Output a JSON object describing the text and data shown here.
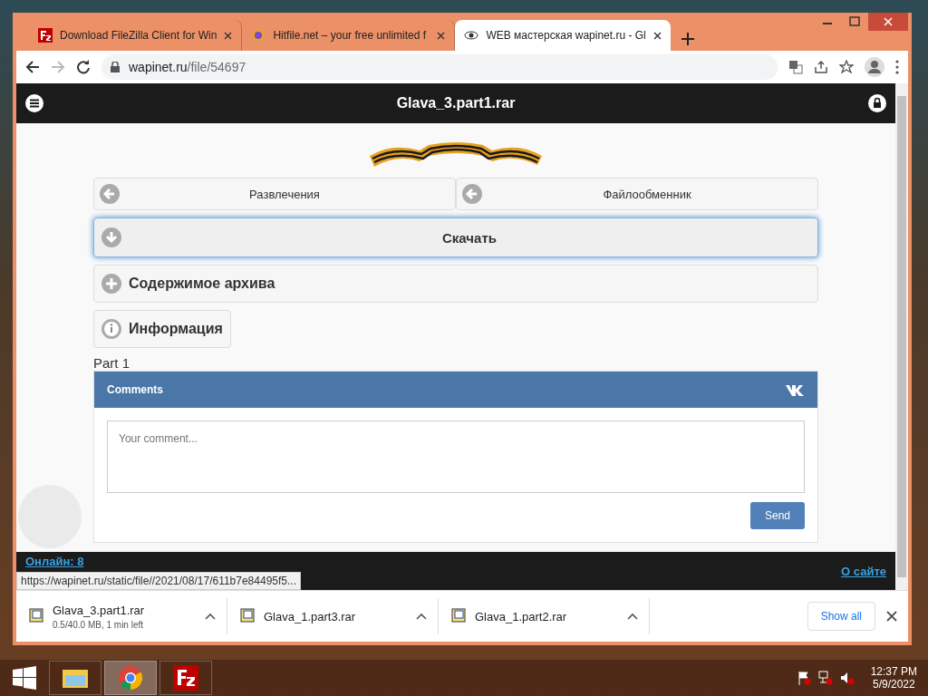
{
  "browser": {
    "tabs": [
      {
        "title": "Download FileZilla Client for Win",
        "kind": "filezilla",
        "selected": false
      },
      {
        "title": "Hitfile.net – your free unlimited f",
        "kind": "hitfile",
        "selected": false
      },
      {
        "title": "WEB мастерская wapinet.ru - Gl",
        "kind": "eye",
        "selected": true
      }
    ],
    "url_host": "wapinet.ru",
    "url_path": "/file/54697"
  },
  "page": {
    "title": "Glava_3.part1.rar",
    "breadcrumbs": [
      {
        "label": "Развлечения"
      },
      {
        "label": "Файлообменник"
      }
    ],
    "sections": [
      {
        "label": "Скачать",
        "kind": "download",
        "focused": true
      },
      {
        "label": "Содержимое архива",
        "kind": "plus",
        "focused": false
      },
      {
        "label": "Информация",
        "kind": "info",
        "focused": false
      }
    ],
    "part_label": "Part 1",
    "comments": {
      "title": "Comments",
      "placeholder": "Your comment...",
      "send": "Send"
    },
    "footer": {
      "online": "Онлайн: 8",
      "about": "О сайте"
    },
    "status_url": "https://wapinet.ru/static/file//2021/08/17/611b7e84495f5..."
  },
  "downloads": {
    "items": [
      {
        "name": "Glava_3.part1.rar",
        "status": "0.5/40.0 MB, 1 min left"
      },
      {
        "name": "Glava_1.part3.rar"
      },
      {
        "name": "Glava_1.part2.rar"
      }
    ],
    "show_all": "Show all"
  },
  "taskbar": {
    "apps": [
      {
        "kind": "explorer",
        "selected": false
      },
      {
        "kind": "chrome",
        "selected": true
      },
      {
        "kind": "filezilla",
        "selected": false
      }
    ],
    "time": "12:37 PM",
    "date": "5/9/2022"
  }
}
